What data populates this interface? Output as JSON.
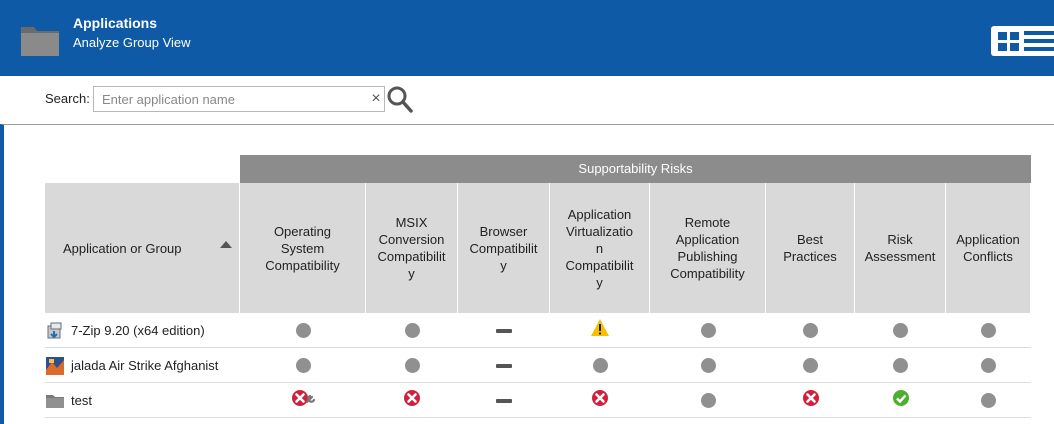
{
  "header": {
    "title": "Applications",
    "subtitle": "Analyze Group View"
  },
  "search": {
    "label": "Search:",
    "placeholder": "Enter application name",
    "value": "",
    "clear_glyph": "×"
  },
  "table": {
    "group_header": "Supportability Risks",
    "app_column": "Application or Group",
    "columns": [
      "Operating System Compatibility",
      "MSIX Conversion Compatibility",
      "Browser Compatibility",
      "Application Virtualization Compatibility",
      "Remote Application Publishing Compatibility",
      "Best Practices",
      "Risk Assessment",
      "Application Conflicts"
    ],
    "columns_wrapped": [
      [
        "Operating",
        "System",
        "Compatibility"
      ],
      [
        "MSIX",
        "Conversion",
        "Compatibilit",
        "y"
      ],
      [
        "Browser",
        "Compatibilit",
        "y"
      ],
      [
        "Application",
        "Virtualizatio",
        "n",
        "Compatibilit",
        "y"
      ],
      [
        "Remote",
        "Application",
        "Publishing",
        "Compatibility"
      ],
      [
        "Best",
        "Practices"
      ],
      [
        "Risk",
        "Assessment"
      ],
      [
        "Application",
        "Conflicts"
      ]
    ],
    "rows": [
      {
        "name": "7-Zip 9.20 (x64 edition)",
        "icon": "installer-icon",
        "statuses": [
          "none",
          "none",
          "not-applicable",
          "warning",
          "none",
          "none",
          "none",
          "none"
        ]
      },
      {
        "name": "jalada Air Strike Afghanist",
        "icon": "game-app-icon",
        "statuses": [
          "none",
          "none",
          "not-applicable",
          "none",
          "none",
          "none",
          "none",
          "none"
        ]
      },
      {
        "name": "test",
        "icon": "folder-icon",
        "statuses": [
          "error-fixable",
          "error",
          "not-applicable",
          "error",
          "none",
          "error",
          "ok",
          "none"
        ]
      }
    ]
  },
  "colors": {
    "header_bg": "#0f5aa6",
    "banner_bg": "#8c8c8c",
    "column_header_bg": "#d9d9d9",
    "error": "#d21f3c",
    "warning": "#f6c000",
    "ok": "#4caf2f",
    "none": "#909090"
  }
}
